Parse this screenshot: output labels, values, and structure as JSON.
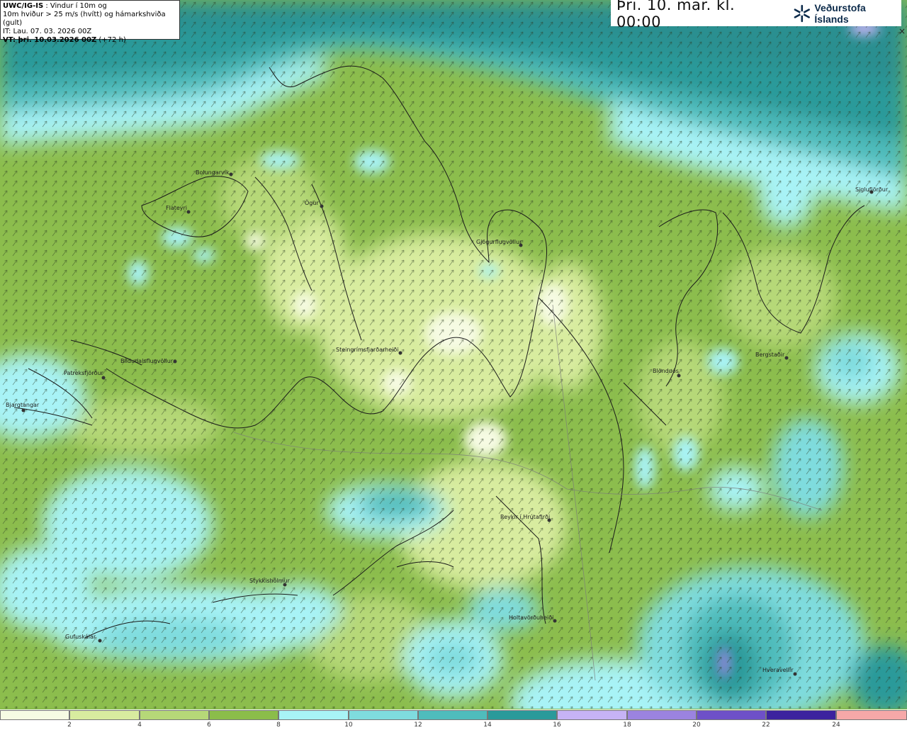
{
  "info": {
    "model": "UWC/IG-IS",
    "desc1": ": Vindur í 10m og",
    "desc2": "10m hviður > 25 m/s (hvítt) og hámarkshviða (gult)",
    "it": "IT: Lau. 07. 03. 2026 00Z",
    "vt_label": "VT: þri. 10.03.2026 00Z",
    "vt_offset": "(+72 h)"
  },
  "header": {
    "time": "Þri. 10. mar. kl. 00:00",
    "brand": "Veðurstofa Íslands"
  },
  "close_symbol": "×",
  "places": [
    {
      "name": "Bolungarvík"
    },
    {
      "name": "Flateyri"
    },
    {
      "name": "Ögur"
    },
    {
      "name": "Gjögurflugvöllur"
    },
    {
      "name": "Steingrímsfjarðarheiði"
    },
    {
      "name": "Bíldudalsflugvöllur"
    },
    {
      "name": "Patreksfjörður"
    },
    {
      "name": "Bjargtangar"
    },
    {
      "name": "Siglufjörður"
    },
    {
      "name": "Bergstaðir"
    },
    {
      "name": "Blönduós"
    },
    {
      "name": "Reykir í Hrútafirði"
    },
    {
      "name": "Stykkishólmur"
    },
    {
      "name": "Gufuskálar"
    },
    {
      "name": "Holtavörðuheiði"
    },
    {
      "name": "Hveravellir"
    }
  ],
  "legend": {
    "ticks": [
      "2",
      "4",
      "6",
      "8",
      "10",
      "12",
      "14",
      "16",
      "18",
      "20",
      "22",
      "24"
    ],
    "colors": [
      "#f6fbe3",
      "#d8ec9f",
      "#b6d878",
      "#8bbd4a",
      "#a8f3f6",
      "#7fdcde",
      "#4fbcbc",
      "#2a9a9a",
      "#c6b3f5",
      "#9b83e0",
      "#6e50c8",
      "#3c229e",
      "#f6a8a8"
    ]
  }
}
